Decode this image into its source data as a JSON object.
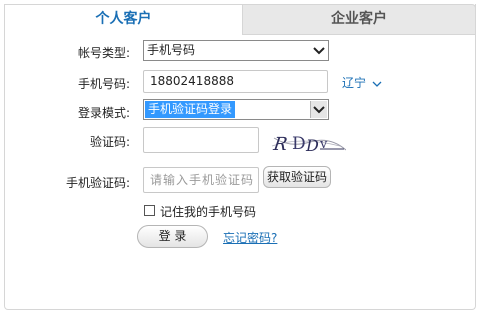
{
  "tabs": {
    "personal": "个人客户",
    "enterprise": "企业客户"
  },
  "form": {
    "account_type": {
      "label": "帐号类型:",
      "value": "手机号码"
    },
    "phone": {
      "label": "手机号码:",
      "value": "18802418888",
      "region": "辽宁"
    },
    "login_mode": {
      "label": "登录模式:",
      "value": "手机验证码登录"
    },
    "captcha": {
      "label": "验证码:",
      "value": "",
      "image_text": "RDDV"
    },
    "sms_code": {
      "label": "手机验证码:",
      "placeholder": "请输入手机验证码",
      "get_code_button": "获取验证码"
    },
    "remember": {
      "label": "记住我的手机号码",
      "checked": false
    },
    "login_button": "登  录",
    "forgot_password": "忘记密码?"
  },
  "icons": {
    "select_arrow": "chevron-down-icon",
    "region_arrow": "chevron-down-icon"
  },
  "colors": {
    "accent": "#1a6fb5",
    "selection": "#3399ff"
  }
}
